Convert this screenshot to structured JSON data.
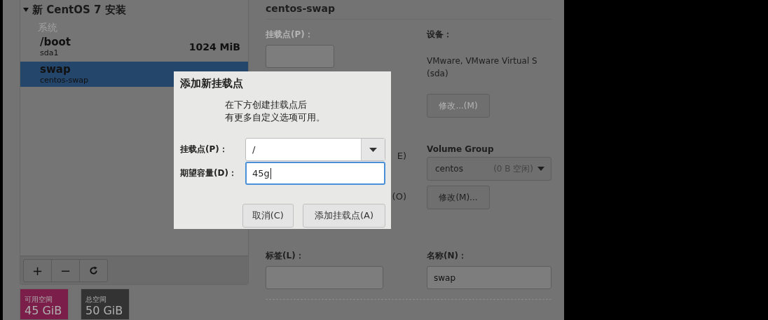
{
  "left_panel": {
    "header": {
      "label": "新 CentOS 7 安装",
      "expanded": true
    },
    "category": "系统",
    "items": [
      {
        "name": "/boot",
        "device": "sda1",
        "size": "1024 MiB",
        "selected": false
      },
      {
        "name": "swap",
        "device": "centos-swap",
        "selected": true
      }
    ],
    "toolbar": [
      {
        "kind": "add",
        "label": "+"
      },
      {
        "kind": "remove",
        "label": "−"
      },
      {
        "kind": "refresh"
      }
    ]
  },
  "storage": [
    {
      "label": "可用空间",
      "value": "45 GiB",
      "color": "#7b1e49"
    },
    {
      "label": "总空间",
      "value": "50 GiB",
      "color": "#333333"
    }
  ],
  "details": {
    "title": "centos-swap",
    "mount_point": {
      "label": "挂载点(P)：",
      "disabled": true
    },
    "hidden_fragments": [
      "E)",
      "(O)"
    ],
    "device": {
      "label": "设备：",
      "value": "VMware, VMware Virtual S (sda)",
      "button": {
        "label": "修改...(M)",
        "disabled": true
      }
    },
    "volume_group": {
      "label": "Volume Group",
      "value": "centos",
      "free": "(0 B 空闲)",
      "button": {
        "label": "修改(M)...",
        "disabled": false
      }
    },
    "tag": {
      "label": "标签(L)："
    },
    "name": {
      "label": "名称(N)：",
      "value": "swap"
    }
  },
  "dialog": {
    "title": "添加新挂载点",
    "message": [
      "在下方创建挂载点后",
      "有更多自定义选项可用。"
    ],
    "mount_point": {
      "label": "挂载点(P)：",
      "value": "/"
    },
    "capacity": {
      "label": "期望容量(D)：",
      "value": "45g",
      "focused": true
    },
    "buttons": [
      {
        "label": "取消(C)",
        "kind": "cancel"
      },
      {
        "label": "添加挂载点(A)",
        "kind": "confirm"
      }
    ]
  }
}
